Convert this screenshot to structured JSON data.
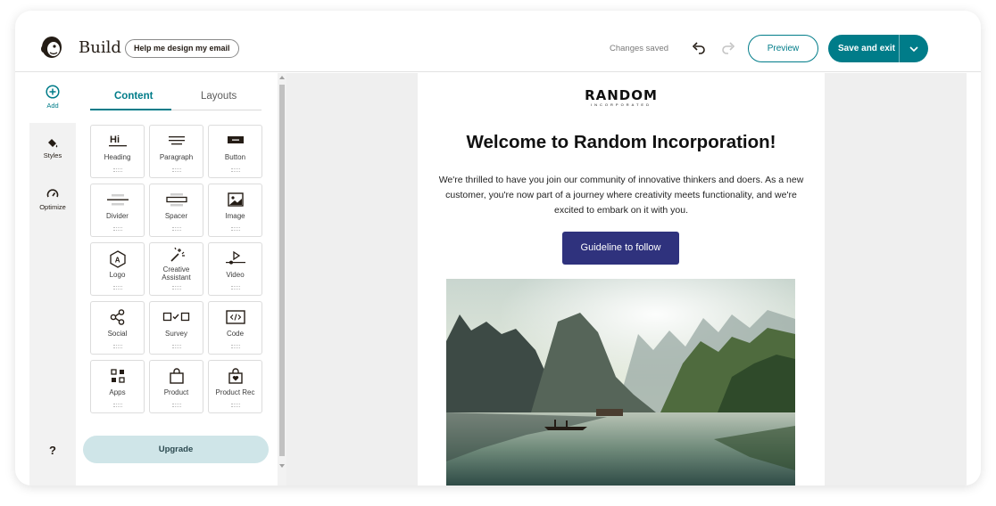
{
  "header": {
    "title": "Build",
    "help_label": "Help me design my email",
    "status": "Changes saved",
    "preview_label": "Preview",
    "save_label": "Save and exit"
  },
  "rail": {
    "add_label": "Add",
    "styles_label": "Styles",
    "optimize_label": "Optimize",
    "help_label": "?"
  },
  "panel": {
    "tabs": [
      "Content",
      "Layouts"
    ],
    "active_tab": "Content",
    "blocks": [
      {
        "label": "Heading",
        "icon": "heading-icon"
      },
      {
        "label": "Paragraph",
        "icon": "paragraph-icon"
      },
      {
        "label": "Button",
        "icon": "button-icon"
      },
      {
        "label": "Divider",
        "icon": "divider-icon"
      },
      {
        "label": "Spacer",
        "icon": "spacer-icon"
      },
      {
        "label": "Image",
        "icon": "image-icon"
      },
      {
        "label": "Logo",
        "icon": "logo-icon"
      },
      {
        "label": "Creative Assistant",
        "icon": "magic-wand-icon"
      },
      {
        "label": "Video",
        "icon": "video-icon"
      },
      {
        "label": "Social",
        "icon": "share-icon"
      },
      {
        "label": "Survey",
        "icon": "survey-icon"
      },
      {
        "label": "Code",
        "icon": "code-icon"
      },
      {
        "label": "Apps",
        "icon": "apps-icon"
      },
      {
        "label": "Product",
        "icon": "shopping-bag-icon"
      },
      {
        "label": "Product Rec",
        "icon": "product-rec-icon"
      }
    ],
    "upgrade_label": "Upgrade"
  },
  "email": {
    "brand_name": "RANDOM",
    "brand_sub": "INCORPORATED",
    "headline": "Welcome to Random Incorporation!",
    "body": "We're thrilled to have you join our community of innovative thinkers and doers. As a new customer, you're now part of a journey where creativity meets functionality, and we're excited to embark on it with you.",
    "cta_label": "Guideline to follow"
  },
  "colors": {
    "accent": "#007c89",
    "cta": "#2f327d",
    "upgrade_bg": "#cfe5e8"
  }
}
